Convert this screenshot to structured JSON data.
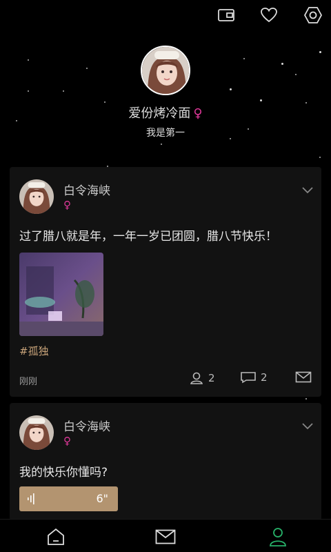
{
  "colors": {
    "accent_gold": "#b39470",
    "female_pink": "#e0389a",
    "active_green": "#27b36a",
    "tag": "#c9a47a"
  },
  "topbar": {
    "icons": [
      "wallet-icon",
      "heart-icon",
      "settings-icon"
    ]
  },
  "profile": {
    "name": "爱份烤冷面",
    "gender_symbol": "♀",
    "signature": "我是第一"
  },
  "posts": [
    {
      "user": "白令海峡",
      "gender_symbol": "♀",
      "text": "过了腊八就是年，一年一岁已团圆，腊八节快乐！",
      "tag": "#孤独",
      "time": "刚刚",
      "likes": "2",
      "comments": "2"
    },
    {
      "user": "白令海峡",
      "gender_symbol": "♀",
      "text": "我的快乐你懂吗?",
      "audio_duration": "6\""
    }
  ],
  "bottom_nav": [
    {
      "name": "home",
      "icon": "home-icon",
      "active": false
    },
    {
      "name": "messages",
      "icon": "mail-icon",
      "active": false
    },
    {
      "name": "profile",
      "icon": "user-icon",
      "active": true
    }
  ]
}
